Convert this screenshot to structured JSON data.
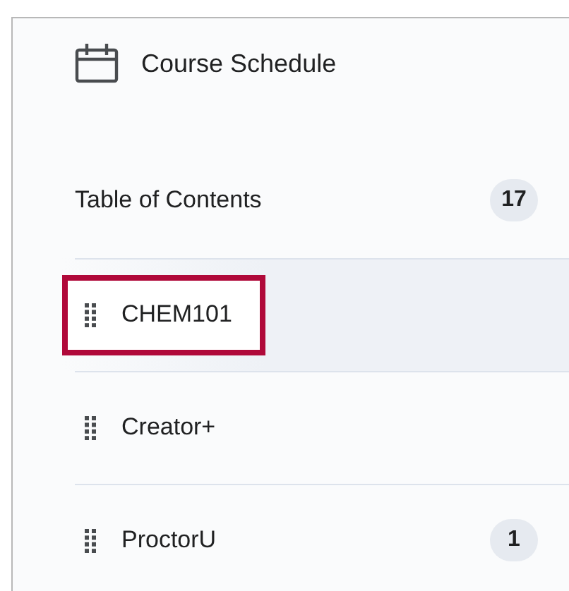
{
  "course_schedule_link": {
    "label": "Course Schedule"
  },
  "table_of_contents": {
    "label": "Table of Contents",
    "count": "17"
  },
  "modules": [
    {
      "label": "CHEM101",
      "selected": true,
      "highlighted": true
    },
    {
      "label": "Creator+",
      "selected": false,
      "highlighted": false
    },
    {
      "label": "ProctorU",
      "selected": false,
      "highlighted": false,
      "count": "1"
    }
  ]
}
